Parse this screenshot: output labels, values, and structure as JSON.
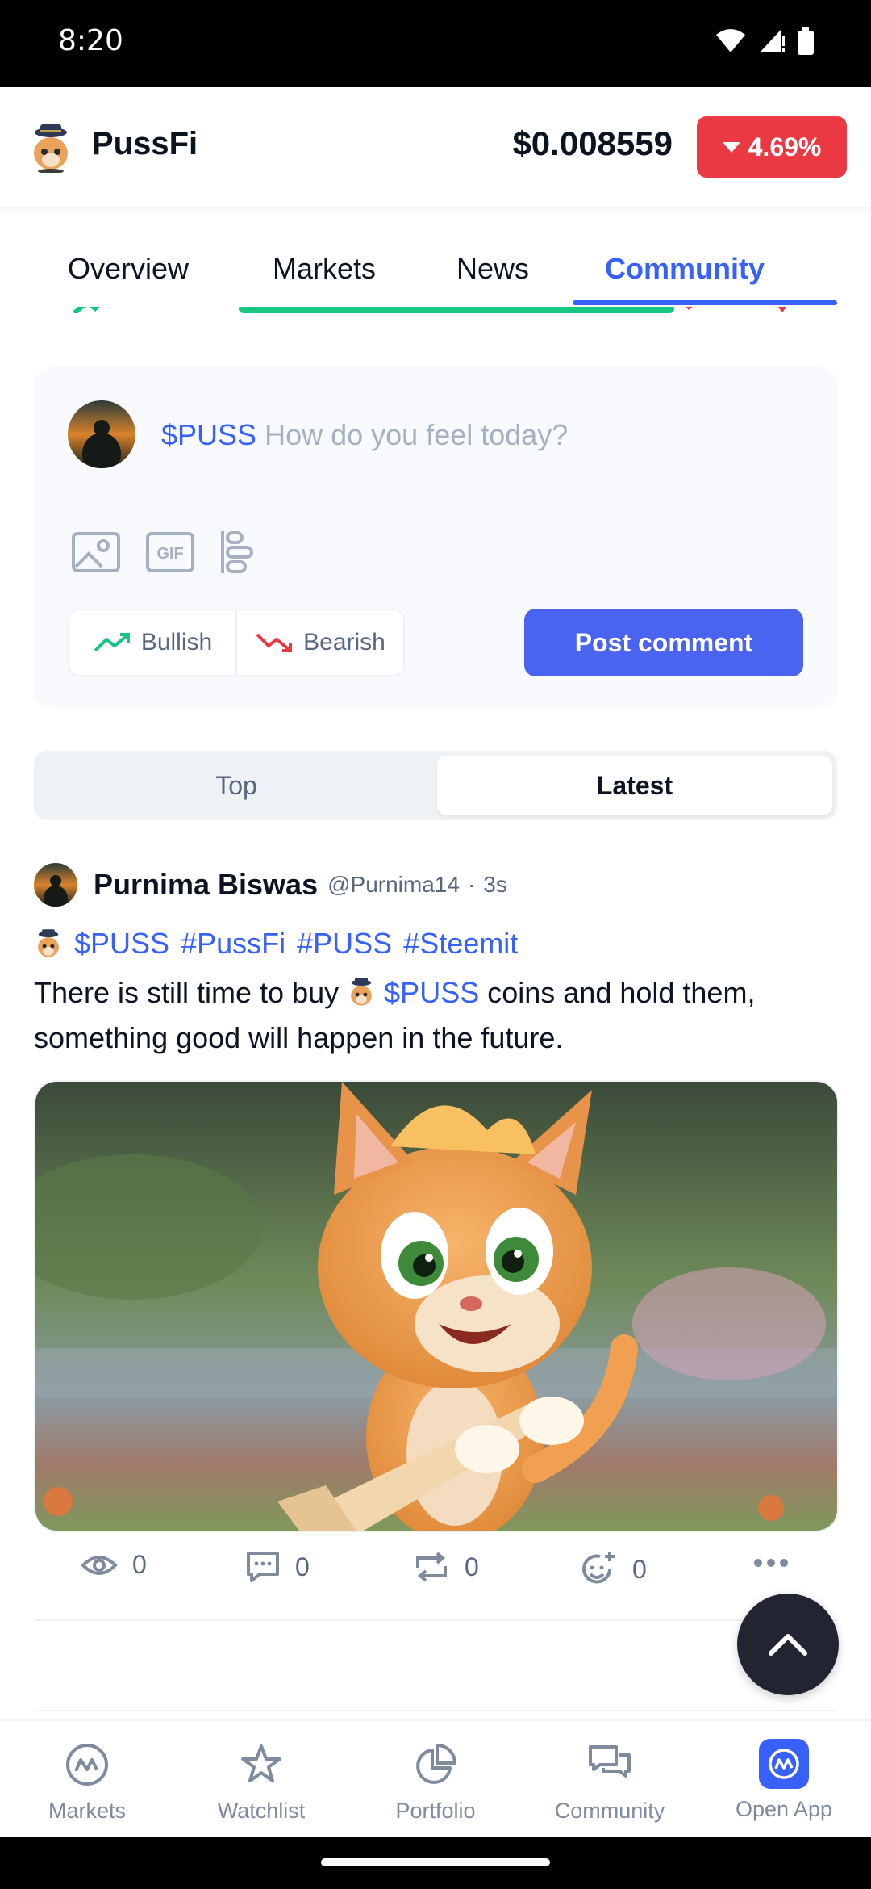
{
  "status_bar": {
    "time": "8:20"
  },
  "header": {
    "coin_name": "PussFi",
    "price": "$0.008559",
    "change": "4.69%",
    "change_color": "#ea3943"
  },
  "tabs": [
    {
      "label": "Overview"
    },
    {
      "label": "Markets"
    },
    {
      "label": "News"
    },
    {
      "label": "Community",
      "active": true
    }
  ],
  "composer": {
    "ticker": "$PUSS",
    "placeholder": "How do you feel today?",
    "bullish_label": "Bullish",
    "bearish_label": "Bearish",
    "post_label": "Post comment"
  },
  "feed_toggle": {
    "top_label": "Top",
    "latest_label": "Latest",
    "selected": "Latest"
  },
  "post": {
    "author": "Purnima Biswas",
    "handle": "@Purnima14",
    "separator": "·",
    "time": "3s",
    "tags": [
      "$PUSS",
      "#PussFi",
      "#PUSS",
      "#Steemit"
    ],
    "body_before": "There is still time to buy",
    "body_link": "$PUSS",
    "body_after": "coins and hold them, something good will happen in the future.",
    "views": "0",
    "comments": "0",
    "reposts": "0",
    "reactions": "0"
  },
  "bottom_nav": [
    {
      "label": "Markets",
      "icon": "cmc-logo-icon"
    },
    {
      "label": "Watchlist",
      "icon": "star-icon"
    },
    {
      "label": "Portfolio",
      "icon": "pie-chart-icon"
    },
    {
      "label": "Community",
      "icon": "chat-bubbles-icon"
    },
    {
      "label": "Open App",
      "icon": "cmc-app-icon"
    }
  ],
  "colors": {
    "accent": "#3861fb",
    "bullish": "#16c784",
    "bearish": "#ea3943",
    "button": "#4a63f0"
  }
}
